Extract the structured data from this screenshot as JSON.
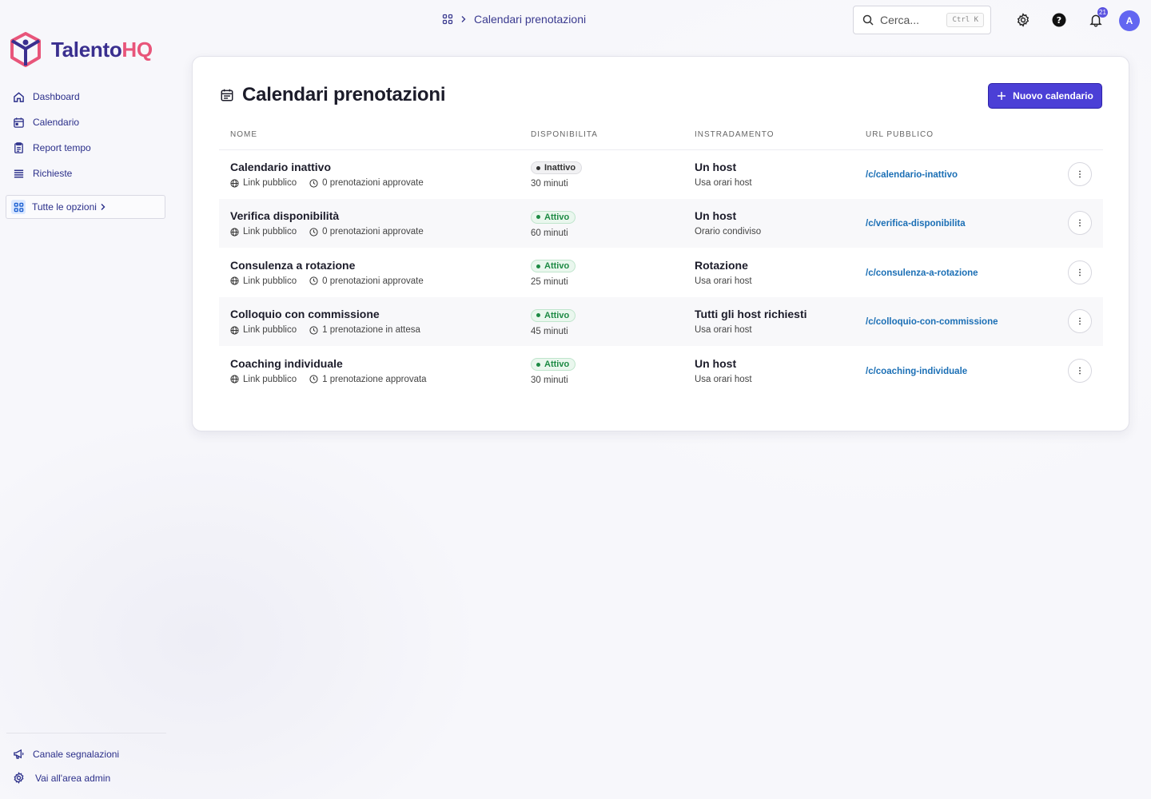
{
  "brand": {
    "name_part1": "Talento",
    "name_part2": "HQ",
    "primary": "#3a2f8f",
    "accent": "#e8557a"
  },
  "sidebar": {
    "items": [
      {
        "label": "Dashboard",
        "icon": "home-icon"
      },
      {
        "label": "Calendario",
        "icon": "calendar-icon"
      },
      {
        "label": "Report tempo",
        "icon": "report-icon"
      },
      {
        "label": "Richieste",
        "icon": "list-icon"
      }
    ],
    "all_options": "Tutte le opzioni",
    "bottom": [
      {
        "label": "Canale segnalazioni",
        "icon": "megaphone-icon"
      },
      {
        "label": "Vai all'area admin",
        "icon": "gear-icon"
      }
    ]
  },
  "header": {
    "breadcrumb": "Calendari prenotazioni",
    "search_placeholder": "Cerca...",
    "search_shortcut": "Ctrl K",
    "notifications_count": "21",
    "avatar_initial": "A"
  },
  "main": {
    "title": "Calendari prenotazioni",
    "new_button": "Nuovo calendario",
    "columns": [
      "NOME",
      "DISPONIBILITA",
      "INSTRADAMENTO",
      "URL PUBBLICO"
    ],
    "rows": [
      {
        "name": "Calendario inattivo",
        "link": "Link pubblico",
        "bookings": "0 prenotazioni approvate",
        "status": "Inattivo",
        "duration": "30 minuti",
        "routing": "Un host",
        "routing_sub": "Usa orari host",
        "url": "/c/calendario-inattivo"
      },
      {
        "name": "Verifica disponibilità",
        "link": "Link pubblico",
        "bookings": "0 prenotazioni approvate",
        "status": "Attivo",
        "duration": "60 minuti",
        "routing": "Un host",
        "routing_sub": "Orario condiviso",
        "url": "/c/verifica-disponibilita"
      },
      {
        "name": "Consulenza a rotazione",
        "link": "Link pubblico",
        "bookings": "0 prenotazioni approvate",
        "status": "Attivo",
        "duration": "25 minuti",
        "routing": "Rotazione",
        "routing_sub": "Usa orari host",
        "url": "/c/consulenza-a-rotazione"
      },
      {
        "name": "Colloquio con commissione",
        "link": "Link pubblico",
        "bookings": "1 prenotazione in attesa",
        "status": "Attivo",
        "duration": "45 minuti",
        "routing": "Tutti gli host richiesti",
        "routing_sub": "Usa orari host",
        "url": "/c/colloquio-con-commissione"
      },
      {
        "name": "Coaching individuale",
        "link": "Link pubblico",
        "bookings": "1 prenotazione approvata",
        "status": "Attivo",
        "duration": "30 minuti",
        "routing": "Un host",
        "routing_sub": "Usa orari host",
        "url": "/c/coaching-individuale"
      }
    ]
  }
}
